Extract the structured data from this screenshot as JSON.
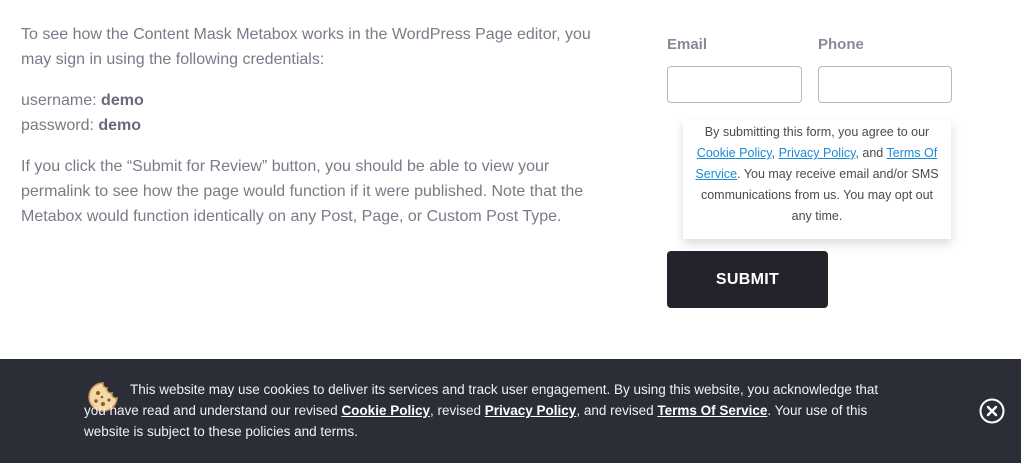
{
  "intro": {
    "paragraph": "To see how the Content Mask Metabox works in the WordPress Page editor, you may sign in using the following credentials:",
    "username_label": "username:",
    "username_value": "demo",
    "password_label": "password:",
    "password_value": "demo",
    "review_paragraph": "If you click the “Submit for Review” button, you should be able to view your permalink to see how the page would function if it were published. Note that the Metabox would function identically on any Post, Page, or Custom Post Type."
  },
  "form": {
    "email_label": "Email",
    "email_value": "",
    "phone_label": "Phone",
    "phone_value": "",
    "consent": {
      "prefix": "By submitting this form, you agree to our ",
      "cookie_link": "Cookie Policy",
      "sep1": ", ",
      "privacy_link": "Privacy Policy",
      "sep2": ", and ",
      "terms_link": "Terms Of Service",
      "suffix": ". You may receive email and/or SMS communications from us. You may opt out any time."
    },
    "submit_label": "SUBMIT"
  },
  "cookie_banner": {
    "icon": "cookie-icon",
    "text1": "This website may use cookies to deliver its services and track user engagement. By using this website, you acknowledge that you have read and understand our revised ",
    "cookie_link": "Cookie Policy",
    "text2": ", revised ",
    "privacy_link": "Privacy Policy",
    "text3": ", and revised ",
    "terms_link": "Terms Of Service",
    "text4": ". Your use of this website is subject to these policies and terms.",
    "close_icon": "close-circle-icon"
  },
  "colors": {
    "body_text": "#7a7a88",
    "link_blue": "#1b8bd4",
    "button_bg": "#23232b",
    "banner_bg": "#2c2e37"
  }
}
